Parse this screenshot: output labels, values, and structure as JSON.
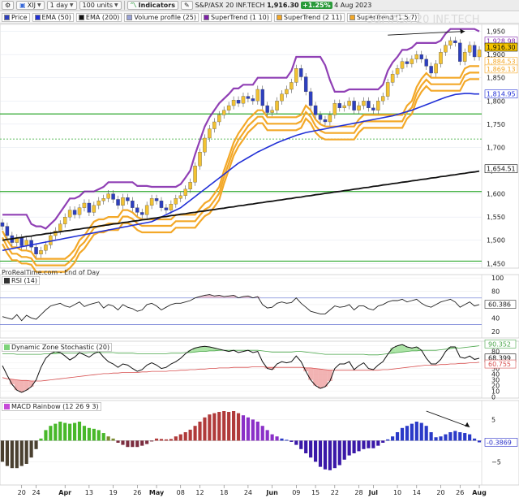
{
  "toolbar": {
    "symbol": "XIJ",
    "interval": "1 day",
    "units": "100 units",
    "indicators_label": "Indicators",
    "instrument": "S&P/ASX 20 INF.TECH",
    "last_price": "1,916.30",
    "change": "+1.25%",
    "date": "4 Aug 2023",
    "watermark": "S&P/ASX 20 INF.TECH"
  },
  "legend": [
    {
      "label": "Price",
      "color": "#2d3fbf"
    },
    {
      "label": "EMA (50)",
      "color": "#2130d6"
    },
    {
      "label": "EMA (200)",
      "color": "#111111"
    },
    {
      "label": "Volume profile (25)",
      "color": "#9aa3d8"
    },
    {
      "label": "SuperTrend (1 10)",
      "color": "#7d1fa8"
    },
    {
      "label": "SuperTrend (2 11)",
      "color": "#f3a828"
    },
    {
      "label": "SuperTrend (1.5 7)",
      "color": "#f3a828"
    }
  ],
  "source": "ProRealTime.com - End of Day",
  "colors": {
    "bull": "#f2c232",
    "bear": "#2d3fbf",
    "ema50": "#2130d6",
    "ema200": "#111111",
    "st_purple": "#7d1fa8",
    "st_orange": "#f3a828",
    "grid_green": "#2ea82e"
  },
  "chart_data": [
    {
      "type": "candlestick",
      "title": "S&P/ASX 20 INF.TECH",
      "x_tick_labels": [
        "20",
        "24",
        "Apr",
        "13",
        "19",
        "26",
        "May",
        "08",
        "12",
        "18",
        "24",
        "Jun",
        "09",
        "15",
        "22",
        "28",
        "Jul",
        "10",
        "14",
        "20",
        "26",
        "Aug"
      ],
      "y_ticks": [
        1450,
        1500,
        1550,
        1600,
        1650,
        1700,
        1750,
        1800,
        1850,
        1900,
        1950
      ],
      "y_tick_labels": [
        "1,450",
        "1,500",
        "1,550",
        "1,600",
        "1,650",
        "1,700",
        "1,750",
        "1,800",
        "1,850",
        "1,900",
        "1,950"
      ],
      "ylim": [
        1440,
        1965
      ],
      "horizontal_levels": [
        1772,
        1605,
        1455,
        1718
      ],
      "close": [
        1530,
        1510,
        1495,
        1505,
        1488,
        1500,
        1485,
        1470,
        1478,
        1490,
        1510,
        1520,
        1535,
        1550,
        1565,
        1555,
        1570,
        1580,
        1560,
        1575,
        1585,
        1590,
        1600,
        1588,
        1575,
        1592,
        1585,
        1570,
        1560,
        1555,
        1575,
        1590,
        1585,
        1570,
        1565,
        1578,
        1590,
        1596,
        1610,
        1625,
        1660,
        1690,
        1720,
        1740,
        1755,
        1770,
        1780,
        1790,
        1802,
        1795,
        1810,
        1805,
        1800,
        1825,
        1790,
        1775,
        1780,
        1800,
        1815,
        1825,
        1840,
        1870,
        1852,
        1820,
        1790,
        1770,
        1760,
        1755,
        1770,
        1795,
        1785,
        1790,
        1800,
        1780,
        1790,
        1800,
        1785,
        1780,
        1800,
        1810,
        1840,
        1858,
        1870,
        1885,
        1880,
        1890,
        1900,
        1890,
        1875,
        1860,
        1880,
        1905,
        1920,
        1930,
        1925,
        1885,
        1905,
        1920,
        1895,
        1910
      ],
      "ema50": [
        1478,
        1480,
        1482,
        1484,
        1486,
        1488,
        1490,
        1492,
        1494,
        1496,
        1498,
        1500,
        1502,
        1504,
        1506,
        1508,
        1510,
        1512,
        1514,
        1516,
        1518,
        1520,
        1522,
        1524,
        1526,
        1528,
        1530,
        1532,
        1534,
        1536,
        1538,
        1540,
        1545,
        1550,
        1555,
        1560,
        1565,
        1570,
        1578,
        1586,
        1594,
        1602,
        1610,
        1618,
        1626,
        1634,
        1642,
        1650,
        1658,
        1666,
        1672,
        1678,
        1684,
        1690,
        1695,
        1700,
        1705,
        1710,
        1714,
        1718,
        1722,
        1726,
        1729,
        1732,
        1734,
        1736,
        1738,
        1740,
        1742,
        1744,
        1746,
        1748,
        1750,
        1752,
        1754,
        1756,
        1758,
        1760,
        1762,
        1764,
        1766,
        1768,
        1771,
        1774,
        1777,
        1780,
        1784,
        1788,
        1792,
        1796,
        1800,
        1804,
        1808,
        1811,
        1814,
        1815,
        1816,
        1816,
        1815,
        1815
      ],
      "ema200": [
        1500,
        1502,
        1503,
        1505,
        1506,
        1508,
        1509,
        1511,
        1512,
        1514,
        1515,
        1517,
        1518,
        1520,
        1521,
        1523,
        1524,
        1526,
        1527,
        1529,
        1530,
        1532,
        1533,
        1535,
        1536,
        1538,
        1539,
        1541,
        1542,
        1544,
        1545,
        1547,
        1548,
        1550,
        1551,
        1553,
        1554,
        1556,
        1557,
        1559,
        1560,
        1562,
        1563,
        1565,
        1566,
        1568,
        1569,
        1571,
        1572,
        1574,
        1575,
        1577,
        1578,
        1580,
        1581,
        1583,
        1584,
        1586,
        1587,
        1589,
        1590,
        1592,
        1593,
        1595,
        1596,
        1598,
        1599,
        1601,
        1602,
        1604,
        1605,
        1607,
        1608,
        1610,
        1611,
        1613,
        1614,
        1616,
        1617,
        1619,
        1620,
        1622,
        1623,
        1625,
        1626,
        1628,
        1629,
        1631,
        1632,
        1634,
        1635,
        1637,
        1638,
        1640,
        1641,
        1643,
        1644,
        1646,
        1647,
        1649
      ],
      "price_labels": [
        {
          "text": "1,928.98",
          "value": 1929,
          "bg": "#ffffff",
          "fg": "#7d1fa8"
        },
        {
          "text": "1,916.30",
          "value": 1916,
          "bg": "#f5c400",
          "fg": "#111111"
        },
        {
          "text": "1,884.53",
          "value": 1885,
          "bg": "#ffffff",
          "fg": "#f3a828"
        },
        {
          "text": "1,869.13",
          "value": 1869,
          "bg": "#ffffff",
          "fg": "#f3a828"
        },
        {
          "text": "1,814.95",
          "value": 1815,
          "bg": "#ffffff",
          "fg": "#2130d6"
        },
        {
          "text": "1,654.51",
          "value": 1654,
          "bg": "#ffffff",
          "fg": "#111111"
        }
      ]
    },
    {
      "type": "line",
      "title": "RSI (14)",
      "y_ticks": [
        20,
        40,
        60,
        80,
        100
      ],
      "ylim": [
        10,
        105
      ],
      "bands": [
        30,
        70
      ],
      "last_label": "60.386",
      "values": [
        42,
        40,
        38,
        45,
        36,
        44,
        40,
        38,
        45,
        52,
        58,
        60,
        62,
        58,
        56,
        60,
        64,
        57,
        60,
        62,
        64,
        55,
        60,
        58,
        52,
        60,
        56,
        54,
        50,
        52,
        60,
        62,
        58,
        52,
        56,
        60,
        62,
        62,
        64,
        66,
        70,
        72,
        74,
        75,
        73,
        74,
        72,
        73,
        74,
        70,
        72,
        73,
        70,
        72,
        60,
        55,
        56,
        62,
        64,
        62,
        63,
        70,
        62,
        56,
        50,
        48,
        46,
        46,
        52,
        58,
        56,
        57,
        60,
        52,
        58,
        58,
        54,
        52,
        58,
        60,
        64,
        66,
        66,
        68,
        64,
        66,
        68,
        62,
        58,
        56,
        60,
        64,
        66,
        68,
        64,
        56,
        60,
        64,
        58,
        60
      ]
    },
    {
      "type": "line",
      "title": "Dynamic Zone Stochastic (20)",
      "y_ticks": [
        0,
        10,
        20,
        30,
        40,
        50,
        60,
        70,
        80,
        90
      ],
      "ylim": [
        -2,
        98
      ],
      "last_labels": [
        "90.352",
        "68.399",
        "60.755"
      ],
      "values": [
        55,
        38,
        22,
        12,
        8,
        12,
        18,
        30,
        52,
        68,
        76,
        80,
        78,
        72,
        65,
        70,
        78,
        74,
        70,
        76,
        80,
        70,
        62,
        58,
        52,
        58,
        56,
        50,
        45,
        48,
        56,
        60,
        56,
        50,
        52,
        58,
        62,
        68,
        76,
        82,
        86,
        88,
        89,
        88,
        86,
        84,
        82,
        80,
        82,
        78,
        80,
        82,
        78,
        80,
        62,
        50,
        48,
        58,
        62,
        60,
        62,
        72,
        62,
        45,
        30,
        20,
        15,
        18,
        28,
        50,
        58,
        58,
        62,
        48,
        55,
        60,
        50,
        48,
        56,
        62,
        75,
        86,
        90,
        92,
        88,
        86,
        88,
        82,
        68,
        58,
        58,
        66,
        80,
        88,
        88,
        70,
        68,
        72,
        66,
        68
      ],
      "upper": [
        76,
        76,
        76,
        75,
        75,
        75,
        75,
        75,
        75,
        76,
        76,
        76,
        77,
        77,
        77,
        77,
        77,
        77,
        78,
        78,
        78,
        78,
        78,
        78,
        77,
        77,
        77,
        77,
        76,
        76,
        76,
        76,
        76,
        76,
        76,
        77,
        77,
        77,
        78,
        78,
        79,
        80,
        80,
        81,
        81,
        82,
        82,
        82,
        82,
        82,
        82,
        82,
        82,
        82,
        81,
        80,
        79,
        79,
        79,
        79,
        79,
        80,
        80,
        79,
        78,
        77,
        76,
        75,
        75,
        75,
        75,
        75,
        75,
        75,
        75,
        75,
        74,
        74,
        74,
        75,
        76,
        77,
        78,
        79,
        80,
        81,
        81,
        82,
        82,
        82,
        82,
        83,
        84,
        85,
        86,
        86,
        87,
        88,
        89,
        90
      ],
      "lower": [
        34,
        32,
        31,
        30,
        29,
        29,
        28,
        28,
        28,
        29,
        30,
        31,
        32,
        33,
        34,
        35,
        36,
        37,
        38,
        39,
        40,
        41,
        41,
        42,
        42,
        43,
        43,
        43,
        43,
        44,
        44,
        45,
        45,
        45,
        45,
        46,
        46,
        47,
        47,
        48,
        48,
        49,
        49,
        50,
        50,
        51,
        51,
        51,
        52,
        52,
        52,
        52,
        53,
        53,
        53,
        52,
        52,
        52,
        52,
        52,
        52,
        52,
        52,
        51,
        51,
        50,
        49,
        48,
        47,
        47,
        47,
        47,
        47,
        47,
        47,
        47,
        47,
        47,
        47,
        48,
        48,
        49,
        50,
        51,
        52,
        53,
        54,
        55,
        56,
        56,
        56,
        57,
        57,
        58,
        58,
        59,
        59,
        60,
        60,
        61
      ]
    },
    {
      "type": "bar",
      "title": "MACD Rainbow (12 26 9 3)",
      "y_ticks": [
        5,
        0,
        -5
      ],
      "y_tick_labels": [
        "5",
        "0",
        "−5"
      ],
      "ylim": [
        -10.5,
        9.5
      ],
      "last_label": "-0.3869",
      "values": [
        -5,
        -6,
        -6.5,
        -6.5,
        -6,
        -5.5,
        -4,
        -2,
        0.5,
        2.5,
        3.5,
        4,
        4.5,
        4.2,
        4,
        4.2,
        4.5,
        3.5,
        3,
        2.8,
        2.5,
        1.8,
        1,
        0.5,
        -0.5,
        -1,
        -1.5,
        -1.5,
        -1.5,
        -1.2,
        -0.8,
        -0.2,
        0.5,
        0.4,
        0.3,
        0.4,
        1,
        1.5,
        2,
        2.6,
        3.5,
        4.5,
        5.5,
        6.2,
        6.5,
        6.8,
        7,
        6.8,
        7,
        6.5,
        6,
        5.5,
        5,
        4.5,
        3.5,
        2.5,
        1.5,
        1,
        0.5,
        0.2,
        -0.3,
        -1,
        -2,
        -3,
        -4,
        -5,
        -6.2,
        -6.8,
        -7,
        -6.5,
        -5.8,
        -4.5,
        -3.5,
        -3,
        -2.5,
        -2,
        -1.8,
        -1.8,
        -1.2,
        -0.5,
        0.3,
        1,
        2,
        3,
        3.5,
        4,
        4.5,
        4.2,
        3.5,
        2,
        0.8,
        1,
        1.5,
        2,
        2.3,
        2,
        1.8,
        1.5,
        0.5,
        -0.4
      ]
    }
  ]
}
